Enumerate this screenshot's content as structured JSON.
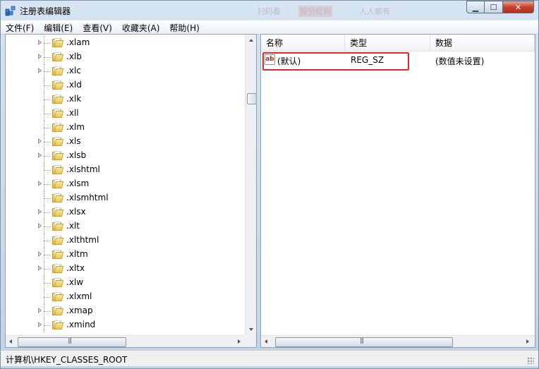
{
  "window": {
    "title": "注册表编辑器"
  },
  "title_ghost": {
    "left": "扫码看",
    "middle": "报价红包",
    "right": "人人都有"
  },
  "caption_buttons": {
    "min": "▁",
    "max": "☐",
    "close": "✕"
  },
  "menu": [
    {
      "label": "文件(F)"
    },
    {
      "label": "编辑(E)"
    },
    {
      "label": "查看(V)"
    },
    {
      "label": "收藏夹(A)"
    },
    {
      "label": "帮助(H)"
    }
  ],
  "tree": {
    "items": [
      {
        "label": ".xlam",
        "expandable": true
      },
      {
        "label": ".xlb",
        "expandable": true
      },
      {
        "label": ".xlc",
        "expandable": true
      },
      {
        "label": ".xld",
        "expandable": false
      },
      {
        "label": ".xlk",
        "expandable": false
      },
      {
        "label": ".xll",
        "expandable": false
      },
      {
        "label": ".xlm",
        "expandable": false
      },
      {
        "label": ".xls",
        "expandable": true
      },
      {
        "label": ".xlsb",
        "expandable": true
      },
      {
        "label": ".xlshtml",
        "expandable": false
      },
      {
        "label": ".xlsm",
        "expandable": true
      },
      {
        "label": ".xlsmhtml",
        "expandable": false
      },
      {
        "label": ".xlsx",
        "expandable": true
      },
      {
        "label": ".xlt",
        "expandable": true
      },
      {
        "label": ".xlthtml",
        "expandable": false
      },
      {
        "label": ".xltm",
        "expandable": true
      },
      {
        "label": ".xltx",
        "expandable": true
      },
      {
        "label": ".xlw",
        "expandable": false
      },
      {
        "label": ".xlxml",
        "expandable": false
      },
      {
        "label": ".xmap",
        "expandable": true
      },
      {
        "label": ".xmind",
        "expandable": true
      }
    ]
  },
  "values_table": {
    "columns": [
      "名称",
      "类型",
      "数据"
    ],
    "rows": [
      {
        "name": "(默认)",
        "type": "REG_SZ",
        "data": "(数值未设置)",
        "icon": "ab"
      }
    ]
  },
  "scrollbar_grip": "|||",
  "status": {
    "path": "计算机\\HKEY_CLASSES_ROOT"
  },
  "colors": {
    "highlight": "#e02b2b",
    "folder": "#edc451",
    "frame": "#c2d3e7"
  }
}
